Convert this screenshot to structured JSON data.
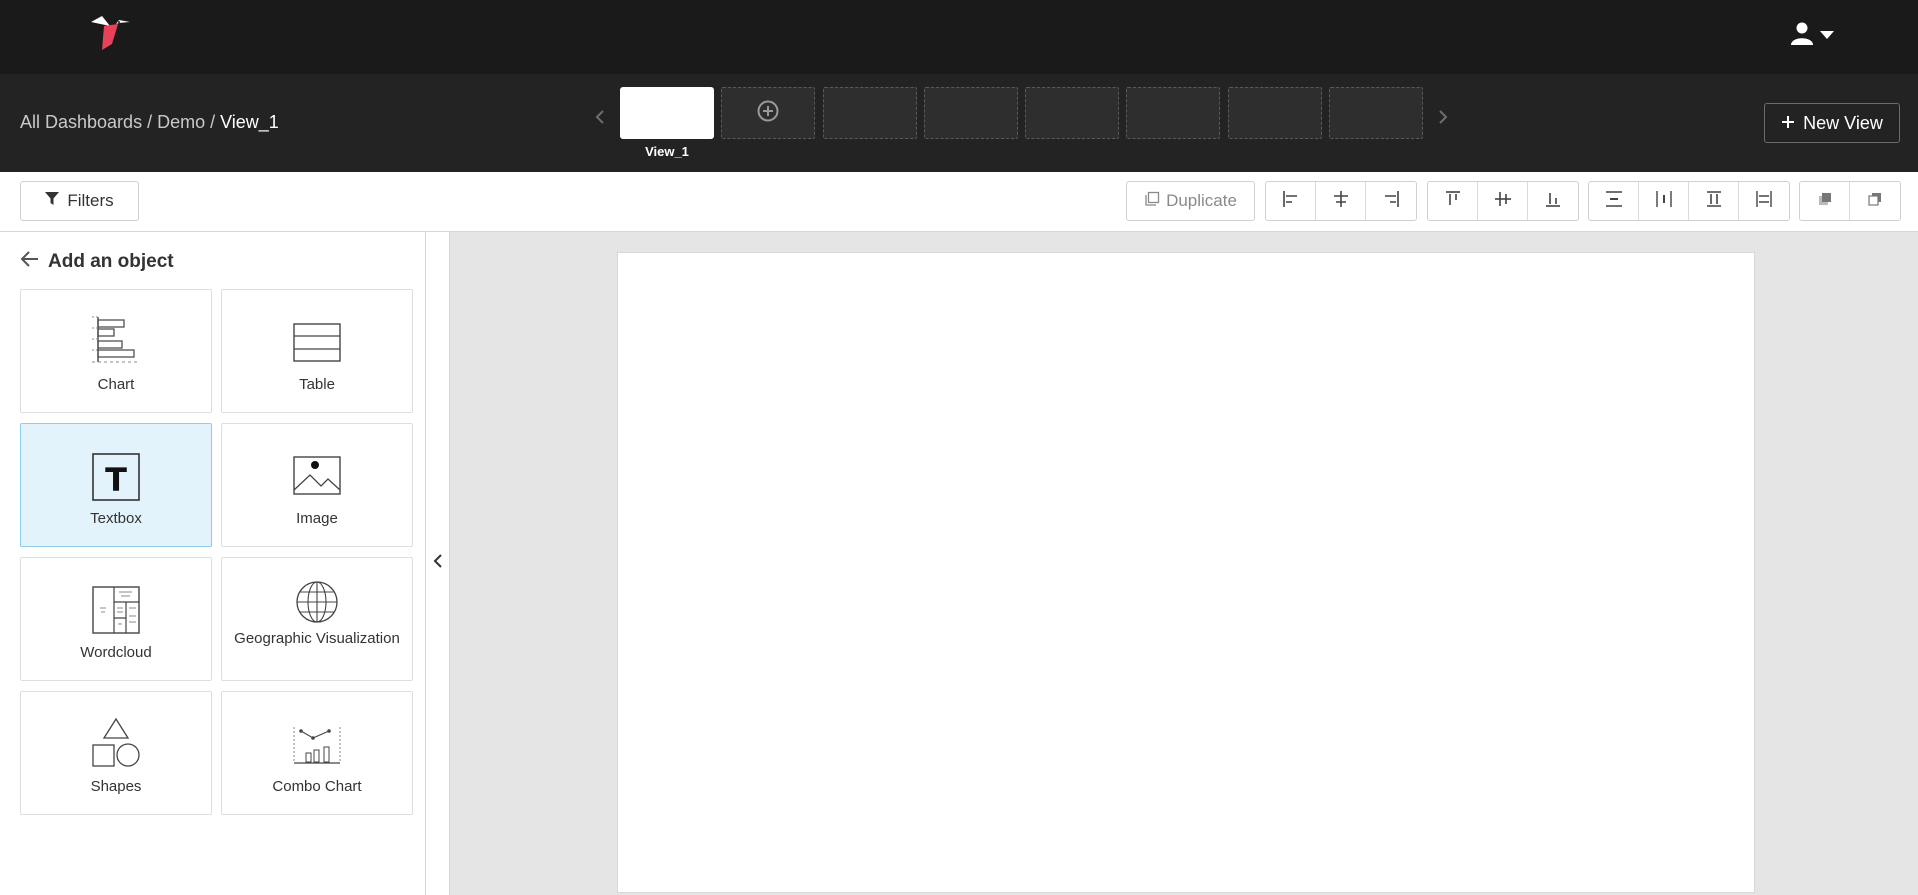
{
  "header": {
    "logo_icon": "hummingbird-logo-icon",
    "user_icon": "user-icon",
    "caret_icon": "caret-down-icon"
  },
  "viewbar": {
    "breadcrumb": {
      "root": "All Dashboards",
      "separator": "/",
      "dashboard": "Demo",
      "current": "View_1"
    },
    "views": [
      {
        "label": "View_1",
        "active": true
      }
    ],
    "add_view_icon": "plus-circle-icon",
    "prev_icon": "chevron-left-icon",
    "next_icon": "chevron-right-icon",
    "new_view_label": "New View",
    "new_view_icon": "plus-icon"
  },
  "toolbar": {
    "filters_label": "Filters",
    "filters_icon": "filter-icon",
    "duplicate_label": "Duplicate",
    "duplicate_icon": "copy-icon",
    "align_horizontal": [
      "align-left-icon",
      "align-center-horizontal-icon",
      "align-right-icon"
    ],
    "align_vertical": [
      "align-top-icon",
      "align-middle-vertical-icon",
      "align-bottom-icon"
    ],
    "distribute": [
      "distribute-vertical-icon",
      "distribute-horizontal-icon",
      "distribute-top-icon",
      "distribute-left-icon"
    ],
    "order": [
      "bring-forward-icon",
      "send-backward-icon"
    ]
  },
  "sidebar": {
    "title": "Add an object",
    "back_icon": "arrow-left-icon",
    "collapse_icon": "chevron-left-icon",
    "objects": [
      {
        "label": "Chart",
        "icon": "bar-chart-icon",
        "selected": false
      },
      {
        "label": "Table",
        "icon": "table-icon",
        "selected": false
      },
      {
        "label": "Textbox",
        "icon": "textbox-icon",
        "selected": true
      },
      {
        "label": "Image",
        "icon": "image-icon",
        "selected": false
      },
      {
        "label": "Wordcloud",
        "icon": "wordcloud-icon",
        "selected": false
      },
      {
        "label": "Geographic Visualization",
        "icon": "globe-icon",
        "selected": false
      },
      {
        "label": "Shapes",
        "icon": "shapes-icon",
        "selected": false
      },
      {
        "label": "Combo Chart",
        "icon": "combo-chart-icon",
        "selected": false
      }
    ]
  },
  "colors": {
    "topbar_bg": "#1a1a1a",
    "viewbar_bg": "#232323",
    "selected_tile_bg": "#e3f3fb",
    "logo_accent": "#e8415a"
  }
}
